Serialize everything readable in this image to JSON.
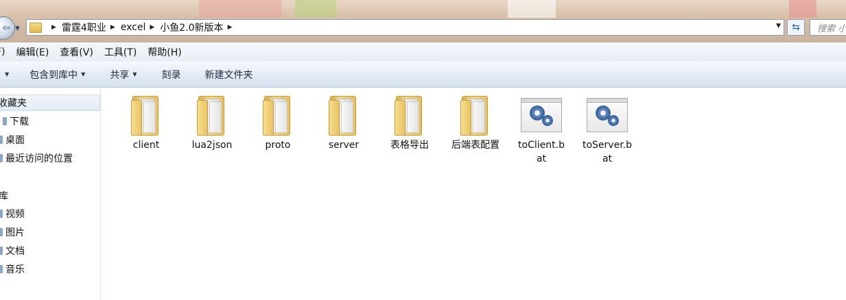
{
  "address": {
    "crumbs": [
      "雷霆4职业",
      "excel",
      "小鱼2.0新版本"
    ]
  },
  "search": {
    "placeholder": "搜索 小鱼"
  },
  "menu": [
    "F)",
    "编辑(E)",
    "查看(V)",
    "工具(T)",
    "帮助(H)"
  ],
  "commands": {
    "first": "",
    "include_library": "包含到库中",
    "share": "共享",
    "burn": "刻录",
    "new_folder": "新建文件夹"
  },
  "sidebar": {
    "favorites": "收藏夹",
    "favorites_items": [
      "下载",
      "桌面",
      "最近访问的位置"
    ],
    "libraries": "库",
    "library_items": [
      "视频",
      "图片",
      "文档",
      "音乐"
    ]
  },
  "files": [
    {
      "name": "client",
      "type": "folder"
    },
    {
      "name": "lua2json",
      "type": "folder"
    },
    {
      "name": "proto",
      "type": "folder"
    },
    {
      "name": "server",
      "type": "folder"
    },
    {
      "name": "表格导出",
      "type": "folder"
    },
    {
      "name": "后端表配置",
      "type": "folder"
    },
    {
      "name": "toClient.bat",
      "type": "bat"
    },
    {
      "name": "toServer.bat",
      "type": "bat"
    }
  ],
  "icons": {
    "folder": "folder-icon",
    "bat": "batch-file-icon",
    "back": "back-arrow-icon",
    "refresh": "refresh-icon"
  },
  "colors": {
    "command_bar": "#dbe4f0",
    "sidebar_selected": "#e4ebf5",
    "address_border": "#8e9fb4"
  }
}
